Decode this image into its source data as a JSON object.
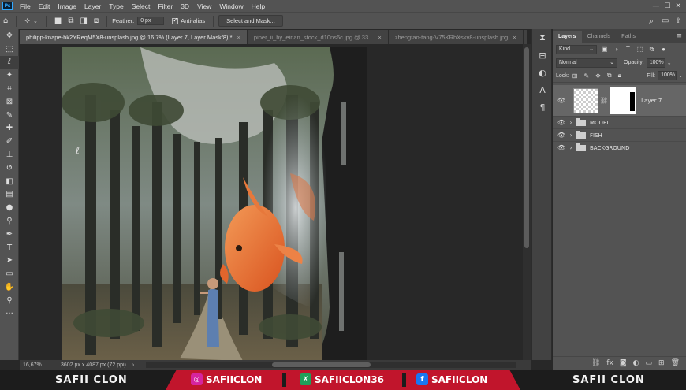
{
  "menu": {
    "items": [
      "File",
      "Edit",
      "Image",
      "Layer",
      "Type",
      "Select",
      "Filter",
      "3D",
      "View",
      "Window",
      "Help"
    ]
  },
  "options": {
    "feather_label": "Feather:",
    "feather_value": "0 px",
    "antialias_label": "Anti-alias",
    "antialias_checked": true,
    "select_mask_label": "Select and Mask..."
  },
  "tabs": [
    {
      "label": "philipp-knape-hk2YReqM5X8-unsplash.jpg @ 16,7% (Layer 7, Layer Mask/8) *",
      "active": true
    },
    {
      "label": "piper_ii_by_eirian_stock_d10ns6c.jpg @ 33...",
      "active": false
    },
    {
      "label": "zhengtao-tang-V75KRhXskv8-unsplash.jpg",
      "active": false
    }
  ],
  "status": {
    "zoom": "16,67%",
    "doc_info": "3602 px x 4087 px (72 ppi)"
  },
  "layers_panel": {
    "tabs": [
      "Layers",
      "Channels",
      "Paths"
    ],
    "filter_label": "Kind",
    "blend_mode": "Normal",
    "opacity_label": "Opacity:",
    "opacity_value": "100%",
    "lock_label": "Lock:",
    "fill_label": "Fill:",
    "fill_value": "100%",
    "layers": [
      {
        "name": "Layer 7",
        "type": "layer",
        "selected": true
      },
      {
        "name": "MODEL",
        "type": "group",
        "selected": false
      },
      {
        "name": "FISH",
        "type": "group",
        "selected": false
      },
      {
        "name": "BACKGROUND",
        "type": "group",
        "selected": false
      }
    ]
  },
  "banner": {
    "left_name": "SAFII CLON",
    "right_name": "SAFII CLON",
    "instagram": "SAFIICLON",
    "deviantart": "SAFIICLON36",
    "facebook": "SAFIICLON"
  },
  "colors": {
    "accent": "#31a8ff",
    "banner_red": "#c1152c",
    "foreground": "#000000",
    "background": "#ffffff"
  }
}
